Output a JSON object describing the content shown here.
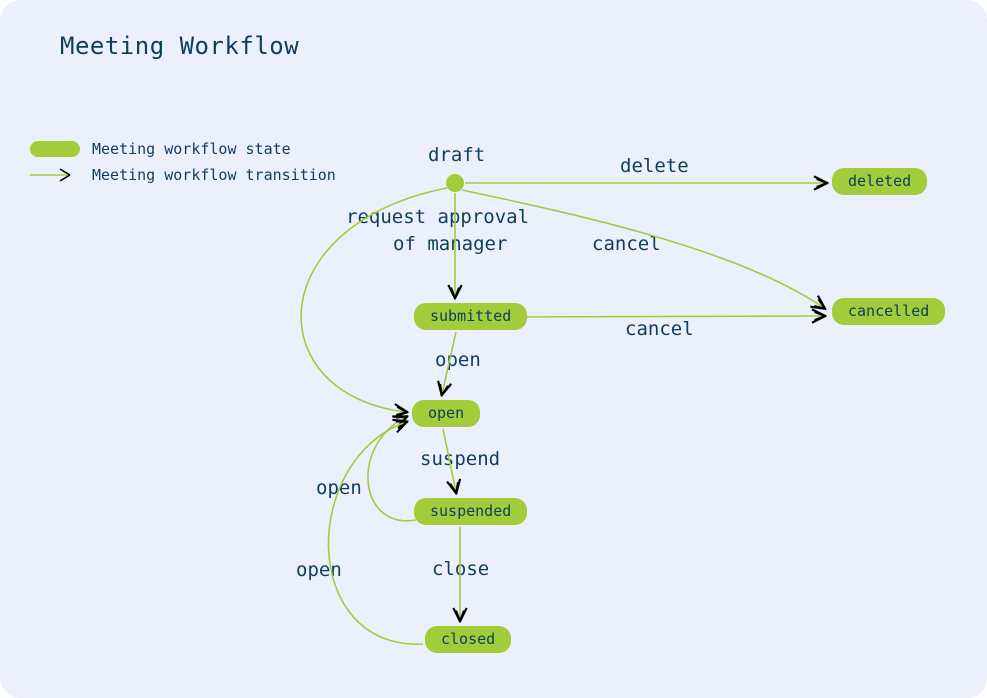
{
  "title": "Meeting Workflow",
  "legend": {
    "state_label": "Meeting workflow state",
    "transition_label": "Meeting workflow transition"
  },
  "states": {
    "draft_label": "draft",
    "submitted": "submitted",
    "open": "open",
    "suspended": "suspended",
    "closed": "closed",
    "deleted": "deleted",
    "cancelled": "cancelled"
  },
  "transitions": {
    "delete": "delete",
    "cancel_from_draft": "cancel",
    "cancel_from_submitted": "cancel",
    "request_approval_line1": "request approval",
    "request_approval_line2": "of manager",
    "open_from_submitted": "open",
    "suspend": "suspend",
    "open_from_suspended": "open",
    "close": "close",
    "open_from_closed": "open"
  },
  "chart_data": {
    "type": "state-diagram",
    "title": "Meeting Workflow",
    "initial_state": "draft",
    "states": [
      "draft",
      "submitted",
      "open",
      "suspended",
      "closed",
      "deleted",
      "cancelled"
    ],
    "transitions": [
      {
        "from": "draft",
        "to": "deleted",
        "label": "delete"
      },
      {
        "from": "draft",
        "to": "cancelled",
        "label": "cancel"
      },
      {
        "from": "draft",
        "to": "submitted",
        "label": "request approval of manager"
      },
      {
        "from": "draft",
        "to": "open",
        "label": ""
      },
      {
        "from": "submitted",
        "to": "cancelled",
        "label": "cancel"
      },
      {
        "from": "submitted",
        "to": "open",
        "label": "open"
      },
      {
        "from": "open",
        "to": "suspended",
        "label": "suspend"
      },
      {
        "from": "suspended",
        "to": "closed",
        "label": "close"
      },
      {
        "from": "suspended",
        "to": "open",
        "label": "open"
      },
      {
        "from": "closed",
        "to": "open",
        "label": "open"
      }
    ]
  }
}
